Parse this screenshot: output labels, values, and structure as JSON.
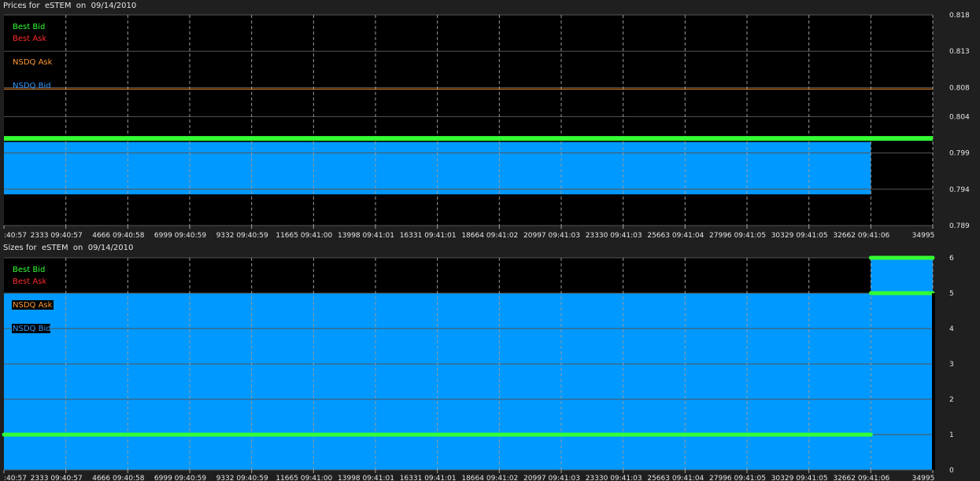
{
  "chart_data": [
    {
      "type": "area",
      "title": "Prices for  eSTEM  on  09/14/2010",
      "legend": [
        {
          "label": "Best Bid",
          "color": "#33ff33"
        },
        {
          "label": "Best Ask",
          "color": "#ff2a2a"
        },
        {
          "label": "NSDQ Ask",
          "color": "#ff9933"
        },
        {
          "label": "NSDQ Bid",
          "color": "#3399ff"
        }
      ],
      "ylim": [
        0.789,
        0.818
      ],
      "y_ticks": [
        "0.818",
        "0.813",
        "0.808",
        "0.804",
        "0.799",
        "0.794",
        "0.789"
      ],
      "xlim": [
        0,
        34995
      ],
      "x_ticks": [
        ":40:57",
        "2333 09:40:57",
        "4666 09:40:58",
        "6999 09:40:59",
        "9332 09:40:59",
        "11665 09:41:00",
        "13998 09:41:01",
        "16331 09:41:01",
        "18664 09:41:02",
        "20997 09:41:03",
        "23330 09:41:03",
        "25663 09:41:04",
        "27996 09:41:05",
        "30329 09:41:05",
        "32662 09:41:06",
        "34995"
      ],
      "series": [
        {
          "name": "NSDQ Bid",
          "color": "#0099ff",
          "x": [
            0,
            32662
          ],
          "y_low": 0.7933,
          "y_high": 0.8005
        },
        {
          "name": "Best Bid",
          "color": "#33ff33",
          "x": [
            0,
            34995
          ],
          "y": [
            0.801,
            0.801
          ]
        },
        {
          "name": "NSDQ Ask",
          "color": "#ff9933",
          "x": [
            0,
            34995
          ],
          "y": [
            0.8078,
            0.8078
          ]
        }
      ]
    },
    {
      "type": "area",
      "title": "Sizes for  eSTEM  on  09/14/2010",
      "legend": [
        {
          "label": "Best Bid",
          "color": "#33ff33"
        },
        {
          "label": "Best Ask",
          "color": "#ff2a2a"
        },
        {
          "label": "NSDQ Ask",
          "color": "#ff9933"
        },
        {
          "label": "NSDQ Bid",
          "color": "#3399ff"
        }
      ],
      "ylim": [
        0,
        6
      ],
      "y_ticks": [
        "6",
        "5",
        "4",
        "3",
        "2",
        "1",
        "0"
      ],
      "xlim": [
        0,
        34995
      ],
      "x_ticks": [
        ":40:57",
        "2333 09:40:57",
        "4666 09:40:58",
        "6999 09:40:59",
        "9332 09:40:59",
        "11665 09:41:00",
        "13998 09:41:01",
        "16331 09:41:01",
        "18664 09:41:02",
        "20997 09:41:03",
        "23330 09:41:03",
        "25663 09:41:04",
        "27996 09:41:05",
        "30329 09:41:05",
        "32662 09:41:06",
        "34995"
      ],
      "series": [
        {
          "name": "NSDQ Bid",
          "color": "#0099ff",
          "steps": [
            {
              "x0": 0,
              "x1": 32662,
              "y": 5
            },
            {
              "x0": 32662,
              "x1": 34995,
              "y": 6
            }
          ]
        },
        {
          "name": "Best Bid",
          "color": "#33ff33",
          "steps": [
            {
              "x0": 0,
              "x1": 32662,
              "y": 1
            },
            {
              "x0": 32662,
              "x1": 34995,
              "y": 5
            },
            {
              "x0": 32662,
              "x1": 34995,
              "y": 6
            }
          ]
        }
      ]
    }
  ]
}
